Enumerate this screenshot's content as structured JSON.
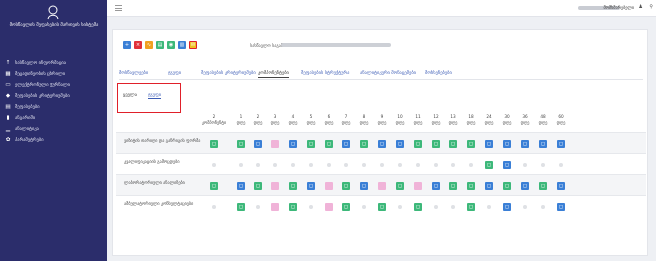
{
  "sidebar": {
    "title": "მოსწავლის შეფასების მართვის სისტემა",
    "items": [
      {
        "icon": "info-icon",
        "label": "სასწავლო ინფორმაცია"
      },
      {
        "icon": "calendar-icon",
        "label": "მეცადინეობის ცხრილი"
      },
      {
        "icon": "monitor-icon",
        "label": "ელექტრონული ჟურნალი"
      },
      {
        "icon": "cap-icon",
        "label": "შეფასების კრიტერიუმები"
      },
      {
        "icon": "grades-icon",
        "label": "შეფასებები"
      },
      {
        "icon": "stats-icon",
        "label": "ანგარიში"
      },
      {
        "icon": "bar-icon",
        "label": "ანალიტიკა"
      },
      {
        "icon": "gear-icon",
        "label": "პარამეტრები"
      }
    ]
  },
  "topbar": {
    "user": "მომხმარებელი",
    "user_icon": "user-icon",
    "search_icon": "search-icon"
  },
  "toolbar": {
    "buttons": [
      {
        "name": "add-button",
        "glyph": "+",
        "color": "#3a7fd6"
      },
      {
        "name": "delete-button",
        "glyph": "×",
        "color": "#e0303a"
      },
      {
        "name": "chart-button",
        "glyph": "∿",
        "color": "#f0a020"
      },
      {
        "name": "excel-button",
        "glyph": "▤",
        "color": "#3db87a"
      },
      {
        "name": "camera-button",
        "glyph": "◉",
        "color": "#3db87a"
      },
      {
        "name": "view-button",
        "glyph": "▥",
        "color": "#3a7fd6"
      },
      {
        "name": "note-button",
        "glyph": "✉",
        "color": "#f0c020"
      }
    ],
    "label": "სასწავლო საგანი:"
  },
  "tabs": [
    "მოსწავლეები",
    "ჯგუფი",
    "შეფასების კრიტერიუმები",
    "კომპონენტები",
    "შეფასების სტრუქტურა",
    "ანალიტიკური მონაცემები",
    "მოხსენებები"
  ],
  "subtabs": {
    "all": "ყველა",
    "group": "ჯგუფი"
  },
  "grid": {
    "columns": [
      {
        "n": "2",
        "s": "კომპონენტი"
      },
      {
        "n": "1",
        "s": "დღე"
      },
      {
        "n": "2",
        "s": "დღე"
      },
      {
        "n": "3",
        "s": "დღე"
      },
      {
        "n": "4",
        "s": "დღე"
      },
      {
        "n": "5",
        "s": "დღე"
      },
      {
        "n": "6",
        "s": "დღე"
      },
      {
        "n": "7",
        "s": "დღე"
      },
      {
        "n": "8",
        "s": "დღე"
      },
      {
        "n": "9",
        "s": "დღე"
      },
      {
        "n": "10",
        "s": "დღე"
      },
      {
        "n": "11",
        "s": "დღე"
      },
      {
        "n": "12",
        "s": "დღე"
      },
      {
        "n": "13",
        "s": "დღე"
      },
      {
        "n": "18",
        "s": "დღე"
      },
      {
        "n": "24",
        "s": "დღე"
      },
      {
        "n": "30",
        "s": "დღე"
      },
      {
        "n": "36",
        "s": "დღე"
      },
      {
        "n": "48",
        "s": "დღე"
      },
      {
        "n": "60",
        "s": "დღე"
      }
    ],
    "rows": [
      {
        "label": "ვიზიტის თარიღი და განრიგის ფორმა",
        "cells": "ggbpbggbgbbggggbbbbb"
      },
      {
        "label": "კვალიფიკაციის გამოცდები",
        "cells": "eeeeeeeeeeeeeeegbeee"
      },
      {
        "label": "ლაბორატორიული ანალიზები",
        "cells": "gbgpgbpgbpgpbggbgbgb"
      },
      {
        "label": "ამბულატორიული კონსულტაციები",
        "cells": "egepgepgegegeegebeeb"
      }
    ]
  }
}
